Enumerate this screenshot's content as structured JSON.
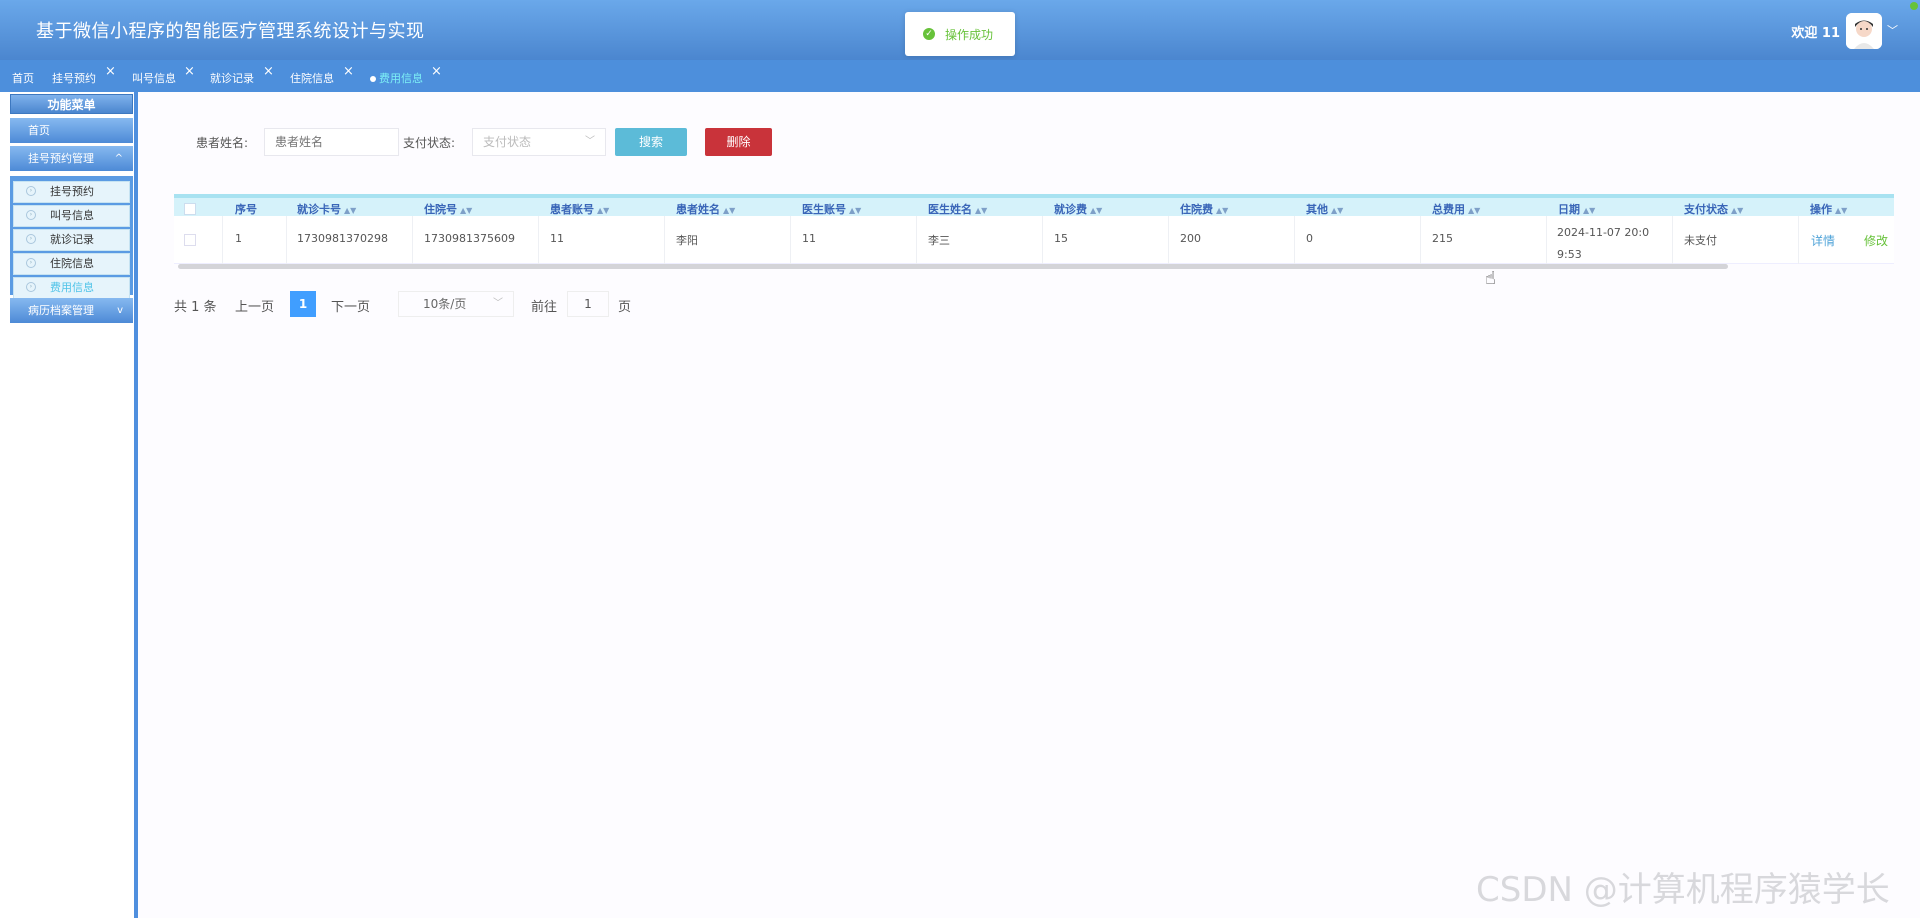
{
  "header": {
    "title": "基于微信小程序的智能医疗管理系统设计与实现",
    "welcome": "欢迎 11",
    "avatar_icon": "user-avatar",
    "dropdown_icon": "chevron-down-icon"
  },
  "toast": {
    "text": "操作成功",
    "icon": "check-circle-icon",
    "color": "#67c23a"
  },
  "tabs": [
    {
      "label": "首页"
    },
    {
      "label": "挂号预约",
      "close": "×"
    },
    {
      "label": "叫号信息",
      "close": "×"
    },
    {
      "label": "就诊记录",
      "close": "×"
    },
    {
      "label": "住院信息",
      "close": "×"
    },
    {
      "label": "费用信息",
      "close": "×",
      "active": true
    }
  ],
  "sidebar": {
    "title": "功能菜单",
    "home": "首页",
    "group1": {
      "label": "挂号预约管理",
      "chevron": "^"
    },
    "sub_items": [
      "挂号预约",
      "叫号信息",
      "就诊记录",
      "住院信息",
      "费用信息"
    ],
    "group2": {
      "label": "病历档案管理",
      "chevron": "v"
    }
  },
  "search": {
    "name_label": "患者姓名:",
    "name_placeholder": "患者姓名",
    "status_label": "支付状态:",
    "status_placeholder": "支付状态",
    "search_button": "搜索",
    "delete_button": "删除"
  },
  "table": {
    "columns": [
      "序号",
      "就诊卡号",
      "住院号",
      "患者账号",
      "患者姓名",
      "医生账号",
      "医生姓名",
      "就诊费",
      "住院费",
      "其他",
      "总费用",
      "日期",
      "支付状态",
      "操作"
    ],
    "rows": [
      {
        "index": "1",
        "card_no": "1730981370298",
        "hosp_no": "1730981375609",
        "patient_account": "11",
        "patient_name": "李阳",
        "doctor_account": "11",
        "doctor_name": "李三",
        "visit_fee": "15",
        "hosp_fee": "200",
        "other": "0",
        "total": "215",
        "date": "2024-11-07 20:09:53",
        "pay_status": "未支付",
        "detail": "详情",
        "edit": "修改"
      }
    ]
  },
  "pagination": {
    "total": "共 1 条",
    "prev": "上一页",
    "current": "1",
    "next": "下一页",
    "page_size": "10条/页",
    "goto_label": "前往",
    "goto_value": "1",
    "page_unit": "页"
  },
  "watermark": "CSDN @计算机程序猿学长"
}
